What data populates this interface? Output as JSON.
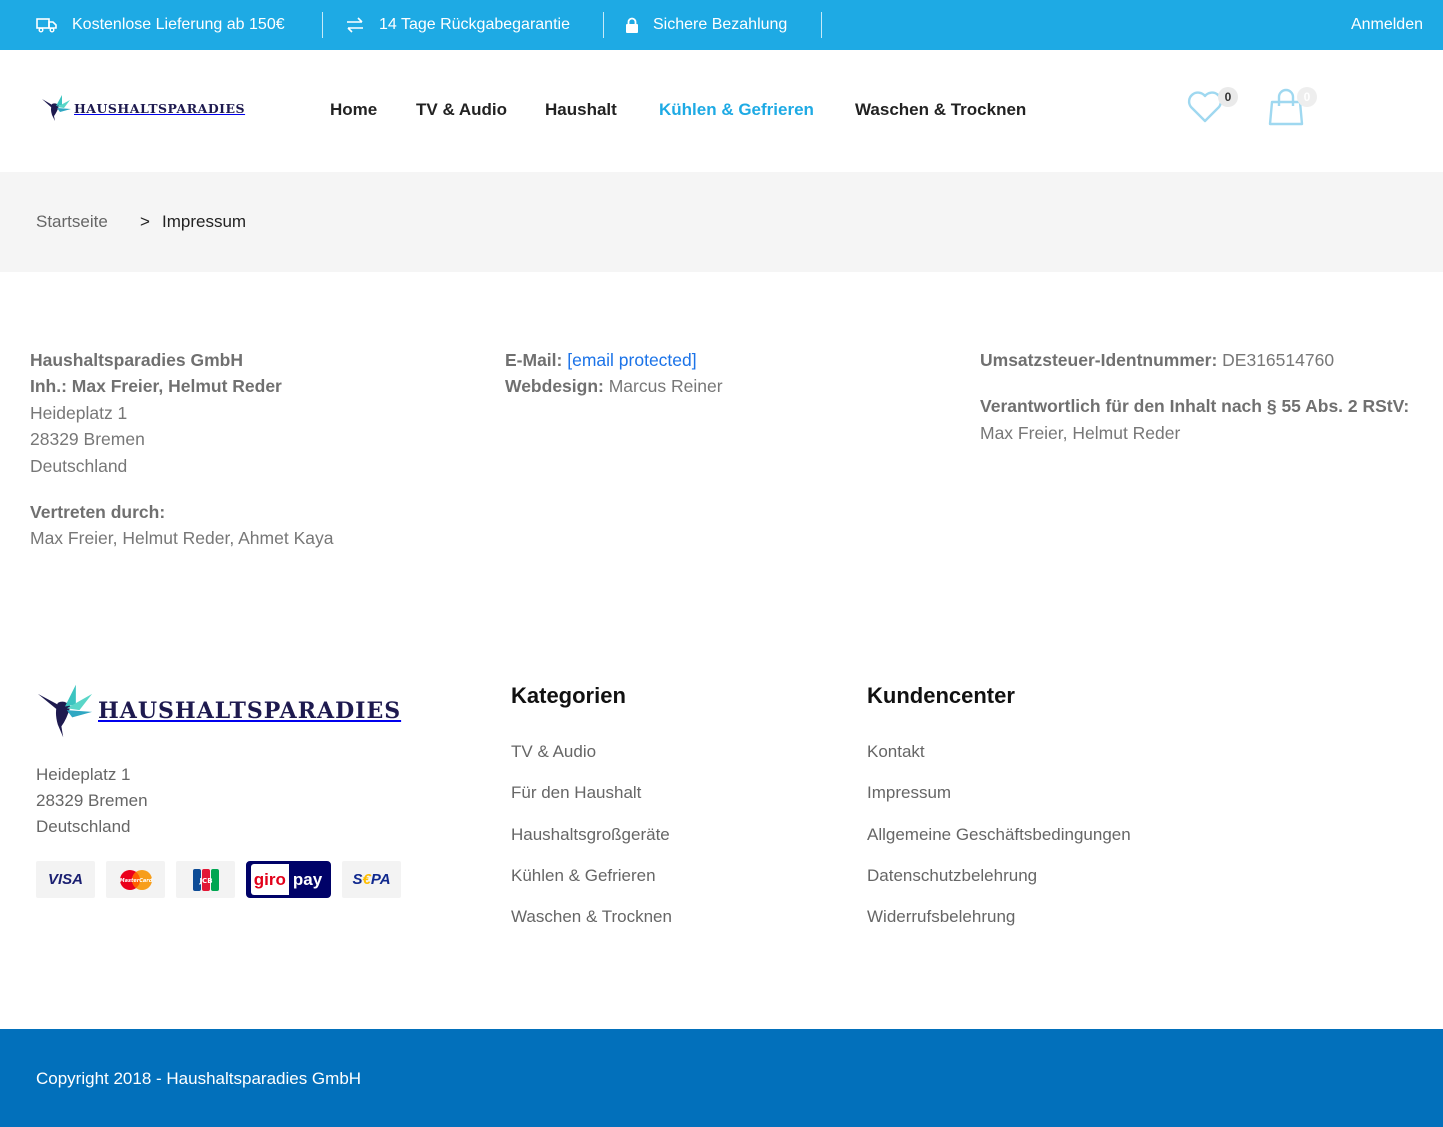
{
  "topbar": {
    "shipping": "Kostenlose Lieferung ab 150€",
    "returns": "14 Tage Rückgabegarantie",
    "payment": "Sichere Bezahlung",
    "login": "Anmelden"
  },
  "header": {
    "logo_text": "HAUSHALTSPARADIES",
    "nav": [
      "Home",
      "TV & Audio",
      "Haushalt",
      "Kühlen & Gefrieren",
      "Waschen & Trocknen"
    ],
    "active_nav": "Kühlen & Gefrieren",
    "wishlist_count": "0",
    "cart_count": "0"
  },
  "breadcrumb": {
    "home": "Startseite",
    "separator": ">",
    "current": "Impressum"
  },
  "imprint": {
    "company": "Haushaltsparadies GmbH",
    "owners": "Inh.: Max Freier, Helmut Reder",
    "street": "Heideplatz 1",
    "city": "28329 Bremen",
    "country": "Deutschland",
    "represented_label": "Vertreten durch:",
    "represented": "Max Freier, Helmut Reder, Ahmet Kaya",
    "email_label": "E-Mail:",
    "email": "[email protected]",
    "webdesign_label": "Webdesign:",
    "webdesign": "Marcus Reiner",
    "vat_label": "Umsatzsteuer-Identnummer:",
    "vat": "DE316514760",
    "responsible_label": "Verantwortlich für den Inhalt nach § 55 Abs. 2 RStV:",
    "responsible": "Max Freier, Helmut Reder"
  },
  "footer": {
    "logo_text": "HAUSHALTSPARADIES",
    "street": "Heideplatz 1",
    "city": "28329 Bremen",
    "country": "Deutschland",
    "payments": {
      "visa": "VISA",
      "mastercard": "MasterCard",
      "jcb": "JCB",
      "giro": "giro",
      "pay": "pay",
      "sepa_s": "S",
      "sepa_e": "€",
      "sepa_pa": "PA"
    },
    "categories_heading": "Kategorien",
    "categories": [
      "TV & Audio",
      "Für den Haushalt",
      "Haushaltsgroßgeräte",
      "Kühlen & Gefrieren",
      "Waschen & Trocknen"
    ],
    "customer_heading": "Kundencenter",
    "customer_links": [
      "Kontakt",
      "Impressum",
      "Allgemeine Geschäftsbedingungen",
      "Datenschutzbelehrung",
      "Widerrufsbelehrung"
    ],
    "copyright": "Copyright 2018 - Haushaltsparadies GmbH"
  },
  "colors": {
    "topbar": "#1eaae4",
    "accent": "#1eaae4",
    "link": "#1b73e8",
    "footer_bar": "#0270bb",
    "brand_dark": "#1e1a4f",
    "brand_teal": "#3bc4c0"
  },
  "icons": [
    "truck-icon",
    "exchange-icon",
    "lock-icon",
    "heart-icon",
    "shopping-bag-icon",
    "hummingbird-logo-icon"
  ]
}
